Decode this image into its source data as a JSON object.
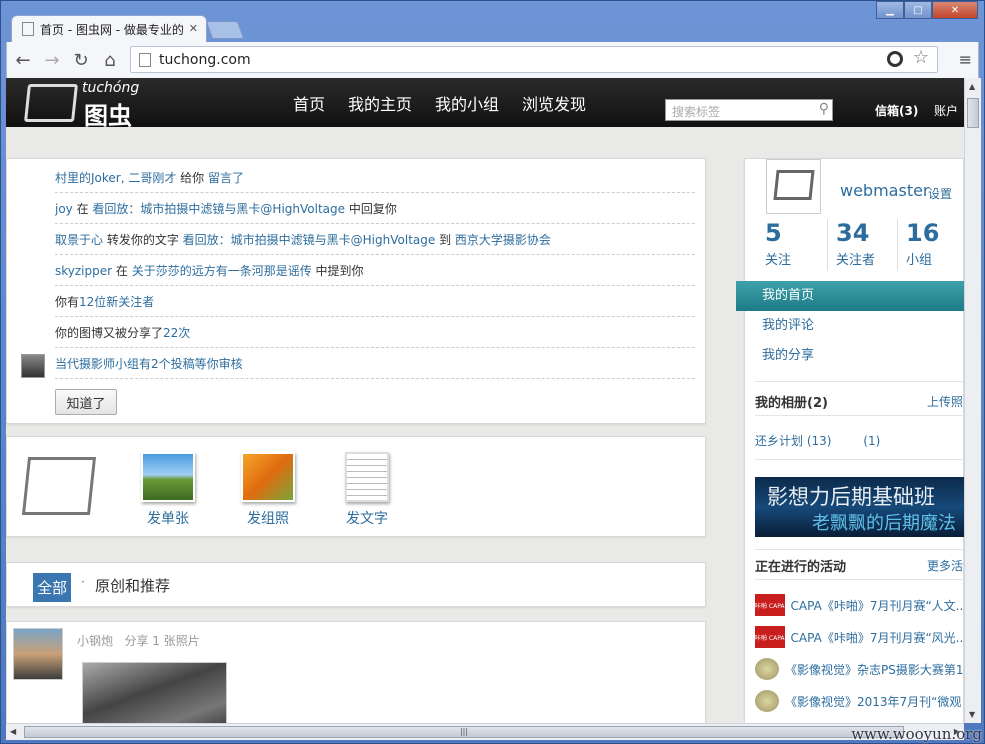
{
  "browser": {
    "tab_title": "首页 - 图虫网 - 做最专业的",
    "url": "tuchong.com",
    "win_min": "▁",
    "win_max": "□",
    "win_close": "✕"
  },
  "site": {
    "logo_pinyin": "tuchóng",
    "logo_cn": "图虫",
    "nav": [
      "首页",
      "我的主页",
      "我的小组",
      "浏览发现"
    ],
    "search_placeholder": "搜索标签",
    "mailbox": "信箱(3)",
    "account": "账户"
  },
  "notifications": [
    {
      "a": "村里的Joker, 二哥刚才",
      "b": " 给你 ",
      "c": "留言了",
      "d": "",
      "e": ""
    },
    {
      "a": "joy",
      "b": " 在 ",
      "c": "看回放：城市拍摄中滤镜与黑卡@HighVoltage",
      "d": " 中回复你",
      "e": ""
    },
    {
      "a": "取景于心",
      "b": " 转发你的文字 ",
      "c": "看回放：城市拍摄中滤镜与黑卡@HighVoltage",
      "d": " 到 ",
      "e": "西京大学摄影协会"
    },
    {
      "a": "skyzipper",
      "b": " 在 ",
      "c": "关于莎莎的远方有一条河那是谣传",
      "d": " 中提到你",
      "e": ""
    },
    {
      "pre": "你有",
      "link": "12位新关注者",
      "post": ""
    },
    {
      "pre": "你的图博又被分享了",
      "link": "22次",
      "post": ""
    },
    {
      "pre": "",
      "link": "当代摄影师小组有2个投稿等你审核",
      "post": ""
    }
  ],
  "ok_button": "知道了",
  "publish": {
    "single": "发单张",
    "group": "发组照",
    "text": "发文字"
  },
  "filter": {
    "all": "全部",
    "sep": "·",
    "original": "原创和推荐"
  },
  "feed": {
    "user": "小钢炮",
    "action": "分享 1 张照片"
  },
  "sidebar": {
    "username": "webmaster",
    "settings": "设置",
    "stats": [
      {
        "n": "5",
        "l": "关注"
      },
      {
        "n": "34",
        "l": "关注者"
      },
      {
        "n": "16",
        "l": "小组"
      }
    ],
    "menu": [
      "我的首页",
      "我的评论",
      "我的分享"
    ],
    "albums_title": "我的相册(2)",
    "upload": "上传照",
    "album1": "还乡计划 (13)",
    "album2": "(1)",
    "banner_line1": "影想力后期基础班",
    "banner_line2": "老飘飘的后期魔法",
    "activities_title": "正在进行的活动",
    "more_activities": "更多活",
    "activities": [
      "CAPA《咔啪》7月刊月赛“人文...",
      "CAPA《咔啪》7月刊月赛“风光...",
      "《影像视觉》杂志PS摄影大赛第1...",
      "《影像视觉》2013年7月刊“微观"
    ],
    "activity_icon_label": "咔啪 CAPA"
  },
  "watermark": "www.wooyun.org",
  "colors": {
    "link": "#2d6d9e",
    "accent": "#1c7b86",
    "header": "#111111"
  }
}
